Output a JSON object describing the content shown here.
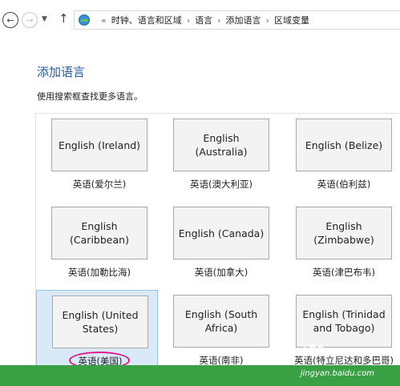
{
  "navigation": {
    "back_icon": "arrow-left-icon",
    "forward_icon": "arrow-right-icon",
    "up_icon": "arrow-up-icon",
    "breadcrumb_prefix": "«",
    "breadcrumbs": [
      "时钟、语言和区域",
      "语言",
      "添加语言",
      "区域变量"
    ],
    "separator": "›"
  },
  "header": {
    "title": "添加语言",
    "subtitle": "使用搜索框查找更多语言。"
  },
  "languages": [
    {
      "tile": "English (Ireland)",
      "caption": "英语(爱尔兰)"
    },
    {
      "tile": "English (Australia)",
      "caption": "英语(澳大利亚)"
    },
    {
      "tile": "English (Belize)",
      "caption": "英语(伯利兹)"
    },
    {
      "tile": "English (Caribbean)",
      "caption": "英语(加勒比海)"
    },
    {
      "tile": "English (Canada)",
      "caption": "英语(加拿大)"
    },
    {
      "tile": "English (Zimbabwe)",
      "caption": "英语(津巴布韦)"
    },
    {
      "tile": "English (United States)",
      "caption": "英语(美国)",
      "selected": true
    },
    {
      "tile": "English (South Africa)",
      "caption": "英语(南非)"
    },
    {
      "tile": "English (Trinidad and Tobago)",
      "caption": "英语(特立尼达和多巴哥)"
    }
  ],
  "colors": {
    "title_blue": "#2b5a9e",
    "selection_bg": "#d9e9f7",
    "highlight_circle": "#e2188a",
    "footer_green": "#3aa044"
  },
  "watermark": "jingyan.baidu.com"
}
